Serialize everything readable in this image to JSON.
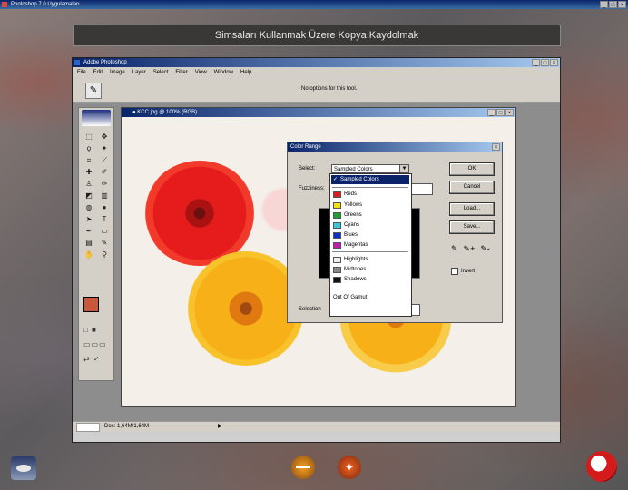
{
  "outer": {
    "title": "Photoshop 7.0 Uygulamaları"
  },
  "banner": {
    "text": "Simsaları Kullanmak Üzere Kopya Kaydolmak"
  },
  "ps": {
    "title": "Adobe Photoshop",
    "menu": [
      "File",
      "Edit",
      "Image",
      "Layer",
      "Select",
      "Filter",
      "View",
      "Window",
      "Help"
    ],
    "options_msg": "No options for this tool.",
    "status_zoom": "",
    "status_msg": "Doc: 1,64M/1,64M",
    "status_arrow": "▶"
  },
  "image_window": {
    "title": "● KCC.jpg @ 100% (RGB)"
  },
  "color_range": {
    "title": "Color Range",
    "select_label": "Select:",
    "select_value": "Sampled Colors",
    "fuzziness_label": "Fuzziness:",
    "selection_label": "Selection",
    "selection_preview_value": "",
    "buttons": {
      "ok": "OK",
      "cancel": "Cancel",
      "load": "Load...",
      "save": "Save..."
    },
    "invert_label": "Invert",
    "droppers": [
      "✎",
      "✎+",
      "✎-"
    ]
  },
  "dropdown": {
    "items": [
      {
        "label": "Sampled Colors",
        "color": "",
        "selected": true,
        "check": "✓"
      },
      {
        "label": "Reds",
        "color": "#d42020"
      },
      {
        "label": "Yellows",
        "color": "#f2e018"
      },
      {
        "label": "Greens",
        "color": "#20a030"
      },
      {
        "label": "Cyans",
        "color": "#40c8d8"
      },
      {
        "label": "Blues",
        "color": "#1030c0"
      },
      {
        "label": "Magentas",
        "color": "#c020b0"
      },
      {
        "label": "Highlights",
        "color": "#f0f0f0"
      },
      {
        "label": "Midtones",
        "color": "#888888"
      },
      {
        "label": "Shadows",
        "color": "#101010"
      },
      {
        "label": "Out Of Gamut",
        "color": ""
      }
    ]
  },
  "colors": {
    "foreground": "#c9573a",
    "background": "#ffffff",
    "accent": "#0a246a"
  }
}
